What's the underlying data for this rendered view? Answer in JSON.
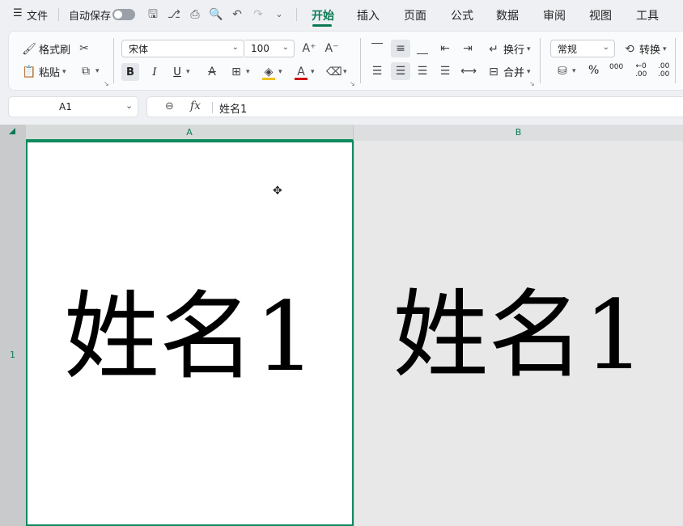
{
  "menubar": {
    "menu_label": "文件",
    "autosave_label": "自动保存",
    "tabs": [
      "开始",
      "插入",
      "页面",
      "公式",
      "数据",
      "审阅",
      "视图",
      "工具"
    ]
  },
  "ribbon": {
    "format_painter": "格式刷",
    "paste": "粘贴",
    "font_name": "宋体",
    "font_size": "100",
    "bold": "B",
    "italic": "I",
    "underline": "U",
    "wrap": "换行",
    "merge": "合并",
    "number_format": "常规",
    "convert": "转换",
    "percent": "%",
    "thousands": "000",
    "dec_decrease": ".00",
    "dec_increase": ".00"
  },
  "formula_bar": {
    "cell_ref": "A1",
    "fx_label": "fx",
    "content": "姓名1"
  },
  "sheet": {
    "col_a": "A",
    "col_b": "B",
    "row_1": "1",
    "cell_a1": "姓名1",
    "cell_b1": "姓名1"
  },
  "colors": {
    "accent": "#0a7a52",
    "selection_border": "#0f8a5f"
  }
}
